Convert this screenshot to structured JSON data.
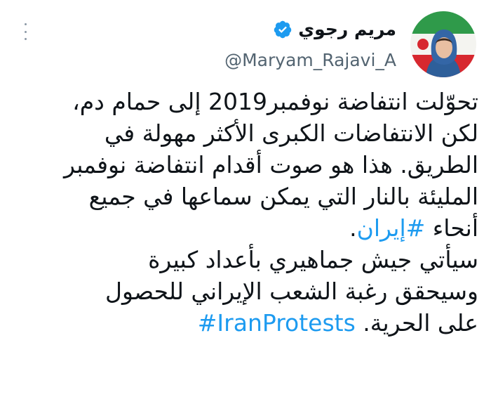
{
  "author": {
    "display_name": "مريم رجوي",
    "handle": "@Maryam_Rajavi_A",
    "avatar_icon": "profile-photo-icon",
    "verified_icon": "verified-badge-icon"
  },
  "menu": {
    "more_icon": "more-options-icon"
  },
  "tweet": {
    "line1": "تحوّلت انتفاضة نوفمبر2019  إلى حمام دم،",
    "line2": "لكن الانتفاضات الكبرى الأكثر مهولة في",
    "line3": "الطريق. هذا هو صوت أقدام انتفاضة نوفمبر",
    "line4": "المليئة بالنار التي يمكن سماعها في جميع",
    "line5_prefix": "أنحاء ",
    "line5_hashtag": "#إيران",
    "line5_suffix": ".",
    "line6": "سيأتي جيش جماهيري بأعداد كبيرة",
    "line7": "وسيحقق رغبة الشعب الإيراني  للحصول",
    "line8_prefix": "على الحرية. ",
    "line8_hashtag": "#IranProtests"
  },
  "colors": {
    "link": "#1d9bf0",
    "text": "#0f1419",
    "secondary": "#536471"
  }
}
